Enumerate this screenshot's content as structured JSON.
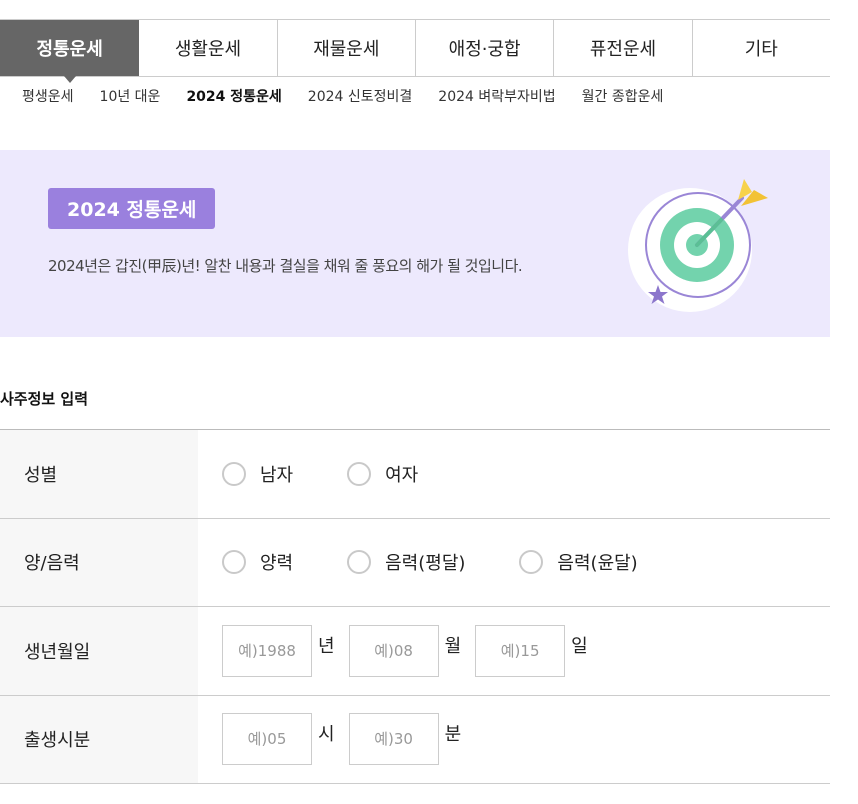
{
  "tabs": [
    {
      "label": "정통운세",
      "active": true
    },
    {
      "label": "생활운세"
    },
    {
      "label": "재물운세"
    },
    {
      "label": "애정·궁합"
    },
    {
      "label": "퓨전운세"
    },
    {
      "label": "기타"
    }
  ],
  "subnav": [
    {
      "label": "평생운세"
    },
    {
      "label": "10년 대운"
    },
    {
      "label": "2024 정통운세",
      "active": true
    },
    {
      "label": "2024 신토정비결"
    },
    {
      "label": "2024 벼락부자비법"
    },
    {
      "label": "월간 종합운세"
    }
  ],
  "banner": {
    "badge": "2024 정통운세",
    "description": "2024년은 갑진(甲辰)년! 알찬 내용과 결실을 채워 줄 풍요의 해가 될 것입니다.",
    "bg_color": "#ede9fd",
    "badge_color": "#9a80de",
    "icon": "target-arrow-icon"
  },
  "form": {
    "title": "사주정보 입력",
    "gender": {
      "label": "성별",
      "options": [
        "남자",
        "여자"
      ]
    },
    "calendar": {
      "label": "양/음력",
      "options": [
        "양력",
        "음력(평달)",
        "음력(윤달)"
      ]
    },
    "birthdate": {
      "label": "생년월일",
      "year_placeholder": "예)1988",
      "year_unit": "년",
      "month_placeholder": "예)08",
      "month_unit": "월",
      "day_placeholder": "예)15",
      "day_unit": "일"
    },
    "birthtime": {
      "label": "출생시분",
      "hour_placeholder": "예)05",
      "hour_unit": "시",
      "minute_placeholder": "예)30",
      "minute_unit": "분"
    }
  }
}
